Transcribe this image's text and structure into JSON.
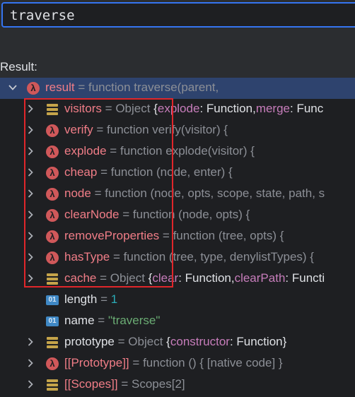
{
  "expression": {
    "value": "traverse"
  },
  "result_label": "Result:",
  "root": {
    "name": "result",
    "eq": "=",
    "value": "function traverse(parent,"
  },
  "children": [
    {
      "icon": "object",
      "name": "visitors",
      "eq": "=",
      "type": "Object",
      "brace": "{",
      "k1": "explode",
      "v1": ": Function,",
      "k2": "merge",
      "v2": ": Func"
    },
    {
      "icon": "function",
      "name": "verify",
      "eq": "=",
      "value": "function verify(visitor) {"
    },
    {
      "icon": "function",
      "name": "explode",
      "eq": "=",
      "value": "function explode(visitor) {"
    },
    {
      "icon": "function",
      "name": "cheap",
      "eq": "=",
      "value": "function (node, enter) {"
    },
    {
      "icon": "function",
      "name": "node",
      "eq": "=",
      "value": "function (node, opts, scope, state, path, s"
    },
    {
      "icon": "function",
      "name": "clearNode",
      "eq": "=",
      "value": "function (node, opts) {"
    },
    {
      "icon": "function",
      "name": "removeProperties",
      "eq": "=",
      "value": "function (tree, opts) {"
    },
    {
      "icon": "function",
      "name": "hasType",
      "eq": "=",
      "value": "function (tree, type, denylistTypes) {"
    },
    {
      "icon": "object",
      "name": "cache",
      "eq": "=",
      "type": "Object",
      "brace": "{",
      "k1": "clear",
      "v1": ": Function,",
      "k2": "clearPath",
      "v2": ": Functi"
    },
    {
      "icon": "primitive",
      "name": "length",
      "eq": "=",
      "value": "1"
    },
    {
      "icon": "primitive",
      "name": "name",
      "eq": "=",
      "value": "\"traverse\""
    },
    {
      "icon": "object",
      "name": "prototype",
      "eq": "=",
      "type": "Object",
      "brace": "{",
      "k1": "constructor",
      "v1": ": Function}"
    },
    {
      "icon": "function",
      "name": "[[Prototype]]",
      "eq": "=",
      "value": "function () { [native code] }"
    },
    {
      "icon": "object",
      "name": "[[Scopes]]",
      "eq": "=",
      "value": "Scopes[2]"
    }
  ],
  "icons": {
    "function": "lambda-icon",
    "object": "object-icon",
    "primitive": "primitive-icon",
    "lambda_glyph": "λ",
    "primitive_glyph": "01"
  },
  "colors": {
    "selection": "#2e436e",
    "highlight_border": "#e0262a",
    "focus_border": "#3574f0"
  }
}
